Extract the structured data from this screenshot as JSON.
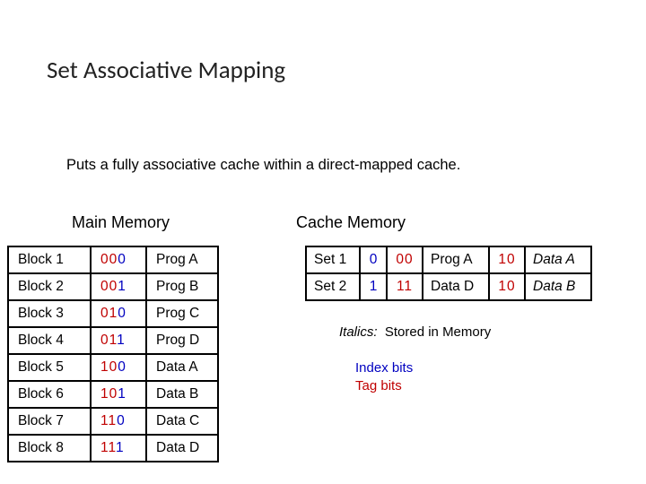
{
  "title": "Set Associative Mapping",
  "subtitle": "Puts a fully associative cache within a direct-mapped cache.",
  "main_memory": {
    "label": "Main Memory",
    "rows": [
      {
        "block": "Block 1",
        "tag": "00",
        "idx": "0",
        "data": "Prog A"
      },
      {
        "block": "Block 2",
        "tag": "00",
        "idx": "1",
        "data": "Prog B"
      },
      {
        "block": "Block 3",
        "tag": "01",
        "idx": "0",
        "data": "Prog C"
      },
      {
        "block": "Block 4",
        "tag": "01",
        "idx": "1",
        "data": "Prog D"
      },
      {
        "block": "Block 5",
        "tag": "10",
        "idx": "0",
        "data": "Data A"
      },
      {
        "block": "Block 6",
        "tag": "10",
        "idx": "1",
        "data": "Data B"
      },
      {
        "block": "Block 7",
        "tag": "11",
        "idx": "0",
        "data": "Data C"
      },
      {
        "block": "Block 8",
        "tag": "11",
        "idx": "1",
        "data": "Data D"
      }
    ]
  },
  "cache_memory": {
    "label": "Cache Memory",
    "rows": [
      {
        "set": "Set 1",
        "idx": "0",
        "tag0": "00",
        "data0": "Prog A",
        "data0_ital": false,
        "tag1": "10",
        "data1": "Data A",
        "data1_ital": true
      },
      {
        "set": "Set 2",
        "idx": "1",
        "tag0": "11",
        "data0": "Data D",
        "data0_ital": false,
        "tag1": "10",
        "data1": "Data B",
        "data1_ital": true
      }
    ]
  },
  "legend": {
    "italics_label": "Italics:",
    "italics_text": "Stored in Memory",
    "index": "Index bits",
    "tag": "Tag bits"
  }
}
